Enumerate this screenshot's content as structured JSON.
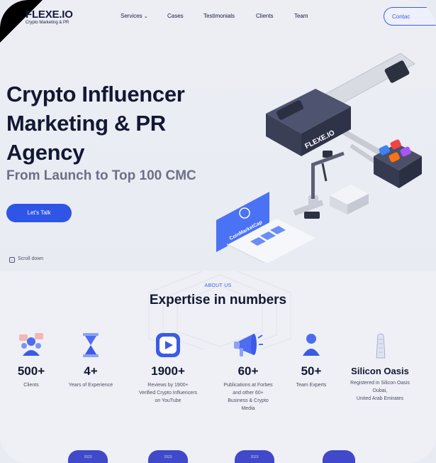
{
  "brand": {
    "name": "FLEXE.IO",
    "tagline": "Crypto Marketing & PR"
  },
  "nav": {
    "items": [
      {
        "label": "Services"
      },
      {
        "label": "Cases"
      },
      {
        "label": "Testimonials"
      },
      {
        "label": "Clients"
      },
      {
        "label": "Team"
      }
    ],
    "contact_label": "Contac"
  },
  "hero": {
    "title_line1": "Crypto Influencer",
    "title_line2": "Marketing & PR",
    "title_line3": "Agency",
    "subtitle": "From Launch to Top 100 CMC",
    "cta_label": "Let's Talk",
    "scroll_label": "Scroll down",
    "illustration_labels": {
      "device": "FLEXE.IO",
      "card": "CoinMarketCap"
    }
  },
  "expertise": {
    "eyebrow": "ABOUT US",
    "title": "Expertise in numbers",
    "stats": [
      {
        "value": "500+",
        "label_lines": [
          "Clients"
        ],
        "icon": "users-icon"
      },
      {
        "value": "4+",
        "label_lines": [
          "Years of Experience"
        ],
        "icon": "hourglass-icon"
      },
      {
        "value": "1900+",
        "label_lines": [
          "Reviews by 1900+",
          "Verified Crypto Influencers",
          "on YouTube"
        ],
        "icon": "youtube-play-icon"
      },
      {
        "value": "60+",
        "label_lines": [
          "Publications at Forbes",
          "and other 60+",
          "Business & Crypto",
          "Media"
        ],
        "icon": "megaphone-icon"
      },
      {
        "value": "50+",
        "label_lines": [
          "Team Experts"
        ],
        "icon": "person-icon"
      },
      {
        "value": "Silicon Oasis",
        "label_lines": [
          "Registered in Silicon Oasis",
          "Dubai,",
          "United Arab Emirates"
        ],
        "icon": "building-icon"
      }
    ],
    "badges": [
      "2023",
      "2023",
      "2023"
    ]
  },
  "colors": {
    "accent": "#3b5cf0",
    "dark_text": "#121833",
    "subtitle_gray": "#6c7085",
    "background": "#eceef4"
  }
}
